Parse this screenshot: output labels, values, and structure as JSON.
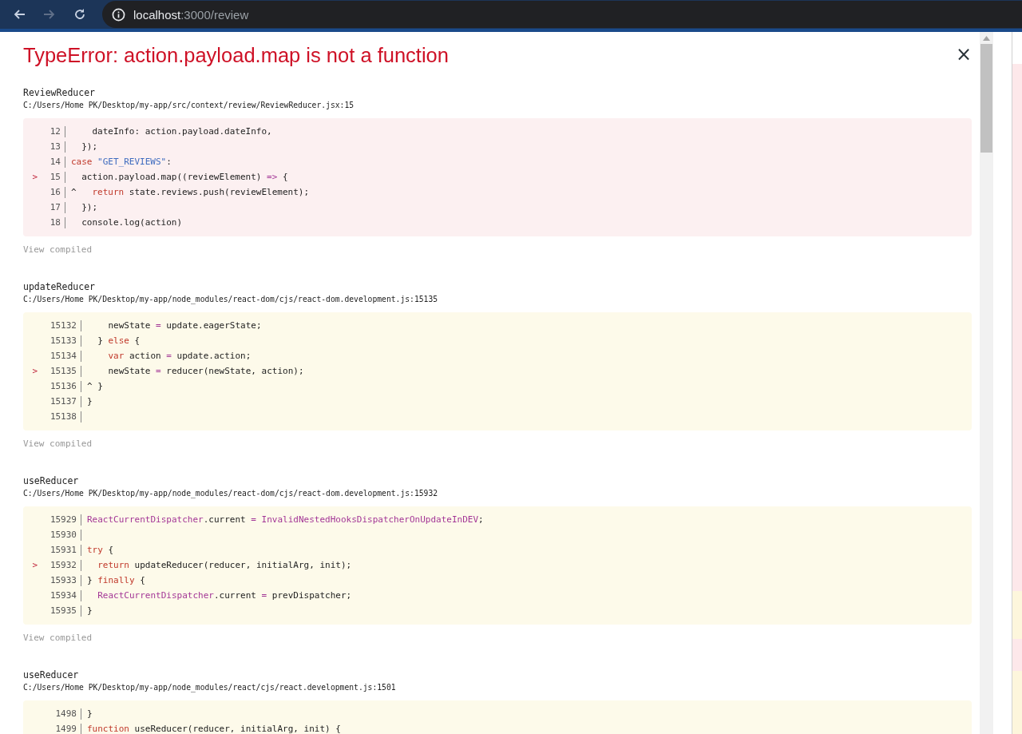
{
  "browser": {
    "nav": [
      {
        "kind": "back",
        "disabled": false
      },
      {
        "kind": "forward",
        "disabled": true
      },
      {
        "kind": "reload",
        "disabled": false
      }
    ],
    "url_host": "localhost",
    "url_path": ":3000/review"
  },
  "overlay": {
    "title": "TypeError: action.payload.map is not a function",
    "close": "×",
    "frames": [
      {
        "name": "ReviewReducer",
        "path": "C:/Users/Home PK/Desktop/my-app/src/context/review/ReviewReducer.jsx:15",
        "kind": "error",
        "view_link": "View compiled",
        "lines": [
          {
            "number": "12",
            "segments": [
              {
                "kind": "plain",
                "text": "    dateInfo: action.payload.dateInfo,"
              }
            ]
          },
          {
            "number": "13",
            "segments": [
              {
                "kind": "plain",
                "text": "  });"
              }
            ]
          },
          {
            "number": "14",
            "segments": [
              {
                "kind": "keyword",
                "text": "case"
              },
              {
                "kind": "string",
                "text": " \"GET_REVIEWS\""
              },
              {
                "kind": "plain",
                "text": ":"
              }
            ]
          },
          {
            "number": "15",
            "marker": ">",
            "segments": [
              {
                "kind": "plain",
                "text": "  action.payload.map((reviewElement) "
              },
              {
                "kind": "operator",
                "text": "=>"
              },
              {
                "kind": "plain",
                "text": " {"
              }
            ]
          },
          {
            "number": "16",
            "segments": [
              {
                "kind": "plain",
                "text": "^   "
              },
              {
                "kind": "keyword",
                "text": "return"
              },
              {
                "kind": "plain",
                "text": " state.reviews.push(reviewElement);"
              }
            ]
          },
          {
            "number": "17",
            "segments": [
              {
                "kind": "plain",
                "text": "  });"
              }
            ]
          },
          {
            "number": "18",
            "segments": [
              {
                "kind": "plain",
                "text": "  console.log(action)"
              }
            ]
          }
        ]
      },
      {
        "name": "updateReducer",
        "path": "C:/Users/Home PK/Desktop/my-app/node_modules/react-dom/cjs/react-dom.development.js:15135",
        "kind": "warning",
        "view_link": "View compiled",
        "lines": [
          {
            "number": "15132",
            "segments": [
              {
                "kind": "plain",
                "text": "    newState "
              },
              {
                "kind": "operator",
                "text": "="
              },
              {
                "kind": "plain",
                "text": " update.eagerState;"
              }
            ]
          },
          {
            "number": "15133",
            "segments": [
              {
                "kind": "plain",
                "text": "  } "
              },
              {
                "kind": "keyword",
                "text": "else"
              },
              {
                "kind": "plain",
                "text": " {"
              }
            ]
          },
          {
            "number": "15134",
            "segments": [
              {
                "kind": "keyword",
                "text": "    var"
              },
              {
                "kind": "plain",
                "text": " action "
              },
              {
                "kind": "operator",
                "text": "="
              },
              {
                "kind": "plain",
                "text": " update.action;"
              }
            ]
          },
          {
            "number": "15135",
            "marker": ">",
            "segments": [
              {
                "kind": "plain",
                "text": "    newState "
              },
              {
                "kind": "operator",
                "text": "="
              },
              {
                "kind": "plain",
                "text": " reducer(newState, action);"
              }
            ]
          },
          {
            "number": "15136",
            "segments": [
              {
                "kind": "plain",
                "text": "^ }"
              }
            ]
          },
          {
            "number": "15137",
            "segments": [
              {
                "kind": "plain",
                "text": "}"
              }
            ]
          },
          {
            "number": "15138"
          }
        ]
      },
      {
        "name": "useReducer",
        "path": "C:/Users/Home PK/Desktop/my-app/node_modules/react-dom/cjs/react-dom.development.js:15932",
        "kind": "warning",
        "view_link": "View compiled",
        "lines": [
          {
            "number": "15929",
            "segments": [
              {
                "kind": "global",
                "text": "ReactCurrentDispatcher"
              },
              {
                "kind": "plain",
                "text": ".current "
              },
              {
                "kind": "operator",
                "text": "="
              },
              {
                "kind": "global",
                "text": " InvalidNestedHooksDispatcherOnUpdateInDEV"
              },
              {
                "kind": "plain",
                "text": ";"
              }
            ]
          },
          {
            "number": "15930"
          },
          {
            "number": "15931",
            "segments": [
              {
                "kind": "keyword",
                "text": "try"
              },
              {
                "kind": "plain",
                "text": " {"
              }
            ]
          },
          {
            "number": "15932",
            "marker": ">",
            "segments": [
              {
                "kind": "keyword",
                "text": "  return"
              },
              {
                "kind": "plain",
                "text": " updateReducer(reducer, initialArg, init);"
              }
            ]
          },
          {
            "number": "15933",
            "segments": [
              {
                "kind": "plain",
                "text": "} "
              },
              {
                "kind": "keyword",
                "text": "finally"
              },
              {
                "kind": "plain",
                "text": " {"
              }
            ]
          },
          {
            "number": "15934",
            "segments": [
              {
                "kind": "global",
                "text": "  ReactCurrentDispatcher"
              },
              {
                "kind": "plain",
                "text": ".current "
              },
              {
                "kind": "operator",
                "text": "="
              },
              {
                "kind": "plain",
                "text": " prevDispatcher;"
              }
            ]
          },
          {
            "number": "15935",
            "segments": [
              {
                "kind": "plain",
                "text": "}"
              }
            ]
          }
        ]
      },
      {
        "name": "useReducer",
        "path": "C:/Users/Home PK/Desktop/my-app/node_modules/react/cjs/react.development.js:1501",
        "kind": "warning",
        "lines": [
          {
            "number": "1498",
            "segments": [
              {
                "kind": "plain",
                "text": "}"
              }
            ]
          },
          {
            "number": "1499",
            "segments": [
              {
                "kind": "keyword",
                "text": "function"
              },
              {
                "kind": "plain",
                "text": " useReducer(reducer, initialArg, init) {"
              }
            ]
          }
        ]
      }
    ]
  }
}
